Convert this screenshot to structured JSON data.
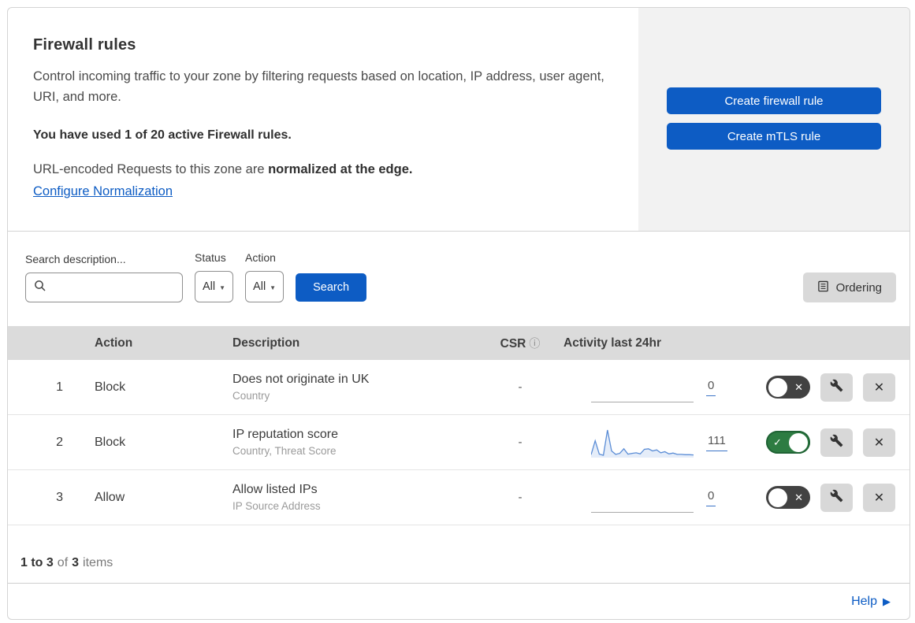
{
  "colors": {
    "primary_blue": "#0d5cc4",
    "panel_gray": "#f2f2f2",
    "table_header_gray": "#dbdbdb",
    "toggle_on_green": "#2d7c42",
    "toggle_off_gray": "#424242",
    "sparkline_blue": "#5b8dd6"
  },
  "icons": {
    "search_icon": "magnifier",
    "dropdown_arrow": "▼",
    "info": "ⓘ",
    "toggle_check": "✓",
    "toggle_x": "✕",
    "close_x": "✕",
    "wrench": "wrench",
    "ordering": "list-document",
    "help_arrow": "▶"
  },
  "header": {
    "title": "Firewall rules",
    "description": "Control incoming traffic to your zone by filtering requests based on location, IP address, user agent, URI, and more.",
    "usage_line": "You have used 1 of 20 active Firewall rules.",
    "normalization_prefix": "URL-encoded Requests to this zone are ",
    "normalization_bold": "normalized at the edge.",
    "normalization_link": "Configure Normalization",
    "create_firewall_button": "Create firewall rule",
    "create_mtls_button": "Create mTLS rule"
  },
  "filters": {
    "search_label": "Search description...",
    "status_label": "Status",
    "status_value": "All",
    "action_label": "Action",
    "action_value": "All",
    "search_button": "Search",
    "ordering_button": "Ordering"
  },
  "table": {
    "columns": {
      "action": "Action",
      "description": "Description",
      "csr": "CSR",
      "activity": "Activity last 24hr"
    },
    "rows": [
      {
        "num": "1",
        "action": "Block",
        "title": "Does not originate in UK",
        "subtitle": "Country",
        "csr": "-",
        "count": "0",
        "enabled": false,
        "sparkline": []
      },
      {
        "num": "2",
        "action": "Block",
        "title": "IP reputation score",
        "subtitle": "Country, Threat Score",
        "csr": "-",
        "count": "111",
        "enabled": true,
        "sparkline": [
          8,
          60,
          10,
          6,
          100,
          22,
          9,
          13,
          30,
          10,
          13,
          15,
          11,
          28,
          30,
          22,
          26,
          15,
          19,
          11,
          14,
          9,
          9,
          8,
          8,
          7
        ]
      },
      {
        "num": "3",
        "action": "Allow",
        "title": "Allow listed IPs",
        "subtitle": "IP Source Address",
        "csr": "-",
        "count": "0",
        "enabled": false,
        "sparkline": []
      }
    ]
  },
  "footer": {
    "range": "1 to 3",
    "of_word": "of",
    "total": "3",
    "items_word": "items",
    "help": "Help"
  }
}
